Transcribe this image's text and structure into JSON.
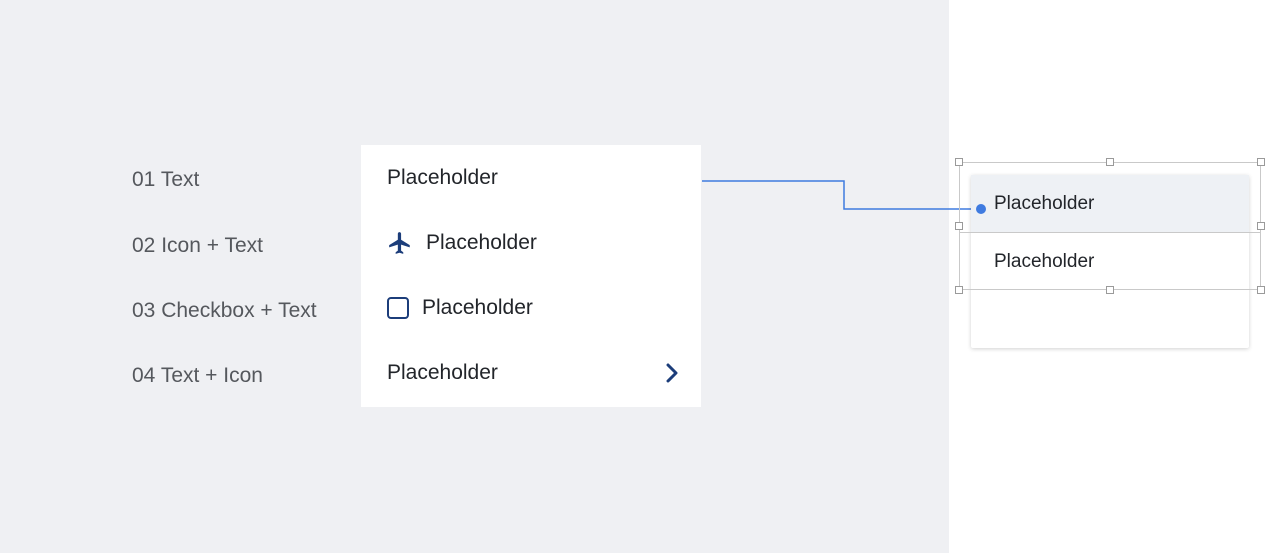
{
  "labels": {
    "row1": "01 Text",
    "row2": "02 Icon + Text",
    "row3": "03 Checkbox + Text",
    "row4": "04 Text + Icon"
  },
  "menu": {
    "item1": "Placeholder",
    "item2": "Placeholder",
    "item3": "Placeholder",
    "item4": "Placeholder"
  },
  "dropdown": {
    "item1": "Placeholder",
    "item2": "Placeholder"
  },
  "icons": {
    "row2": "airplane-icon",
    "row3": "checkbox-icon",
    "row4": "chevron-right-icon"
  },
  "colors": {
    "icon": "#1c3d7a",
    "connector": "#3f7be0",
    "canvas": "#eff0f3",
    "selected_row": "#eef1f5"
  }
}
